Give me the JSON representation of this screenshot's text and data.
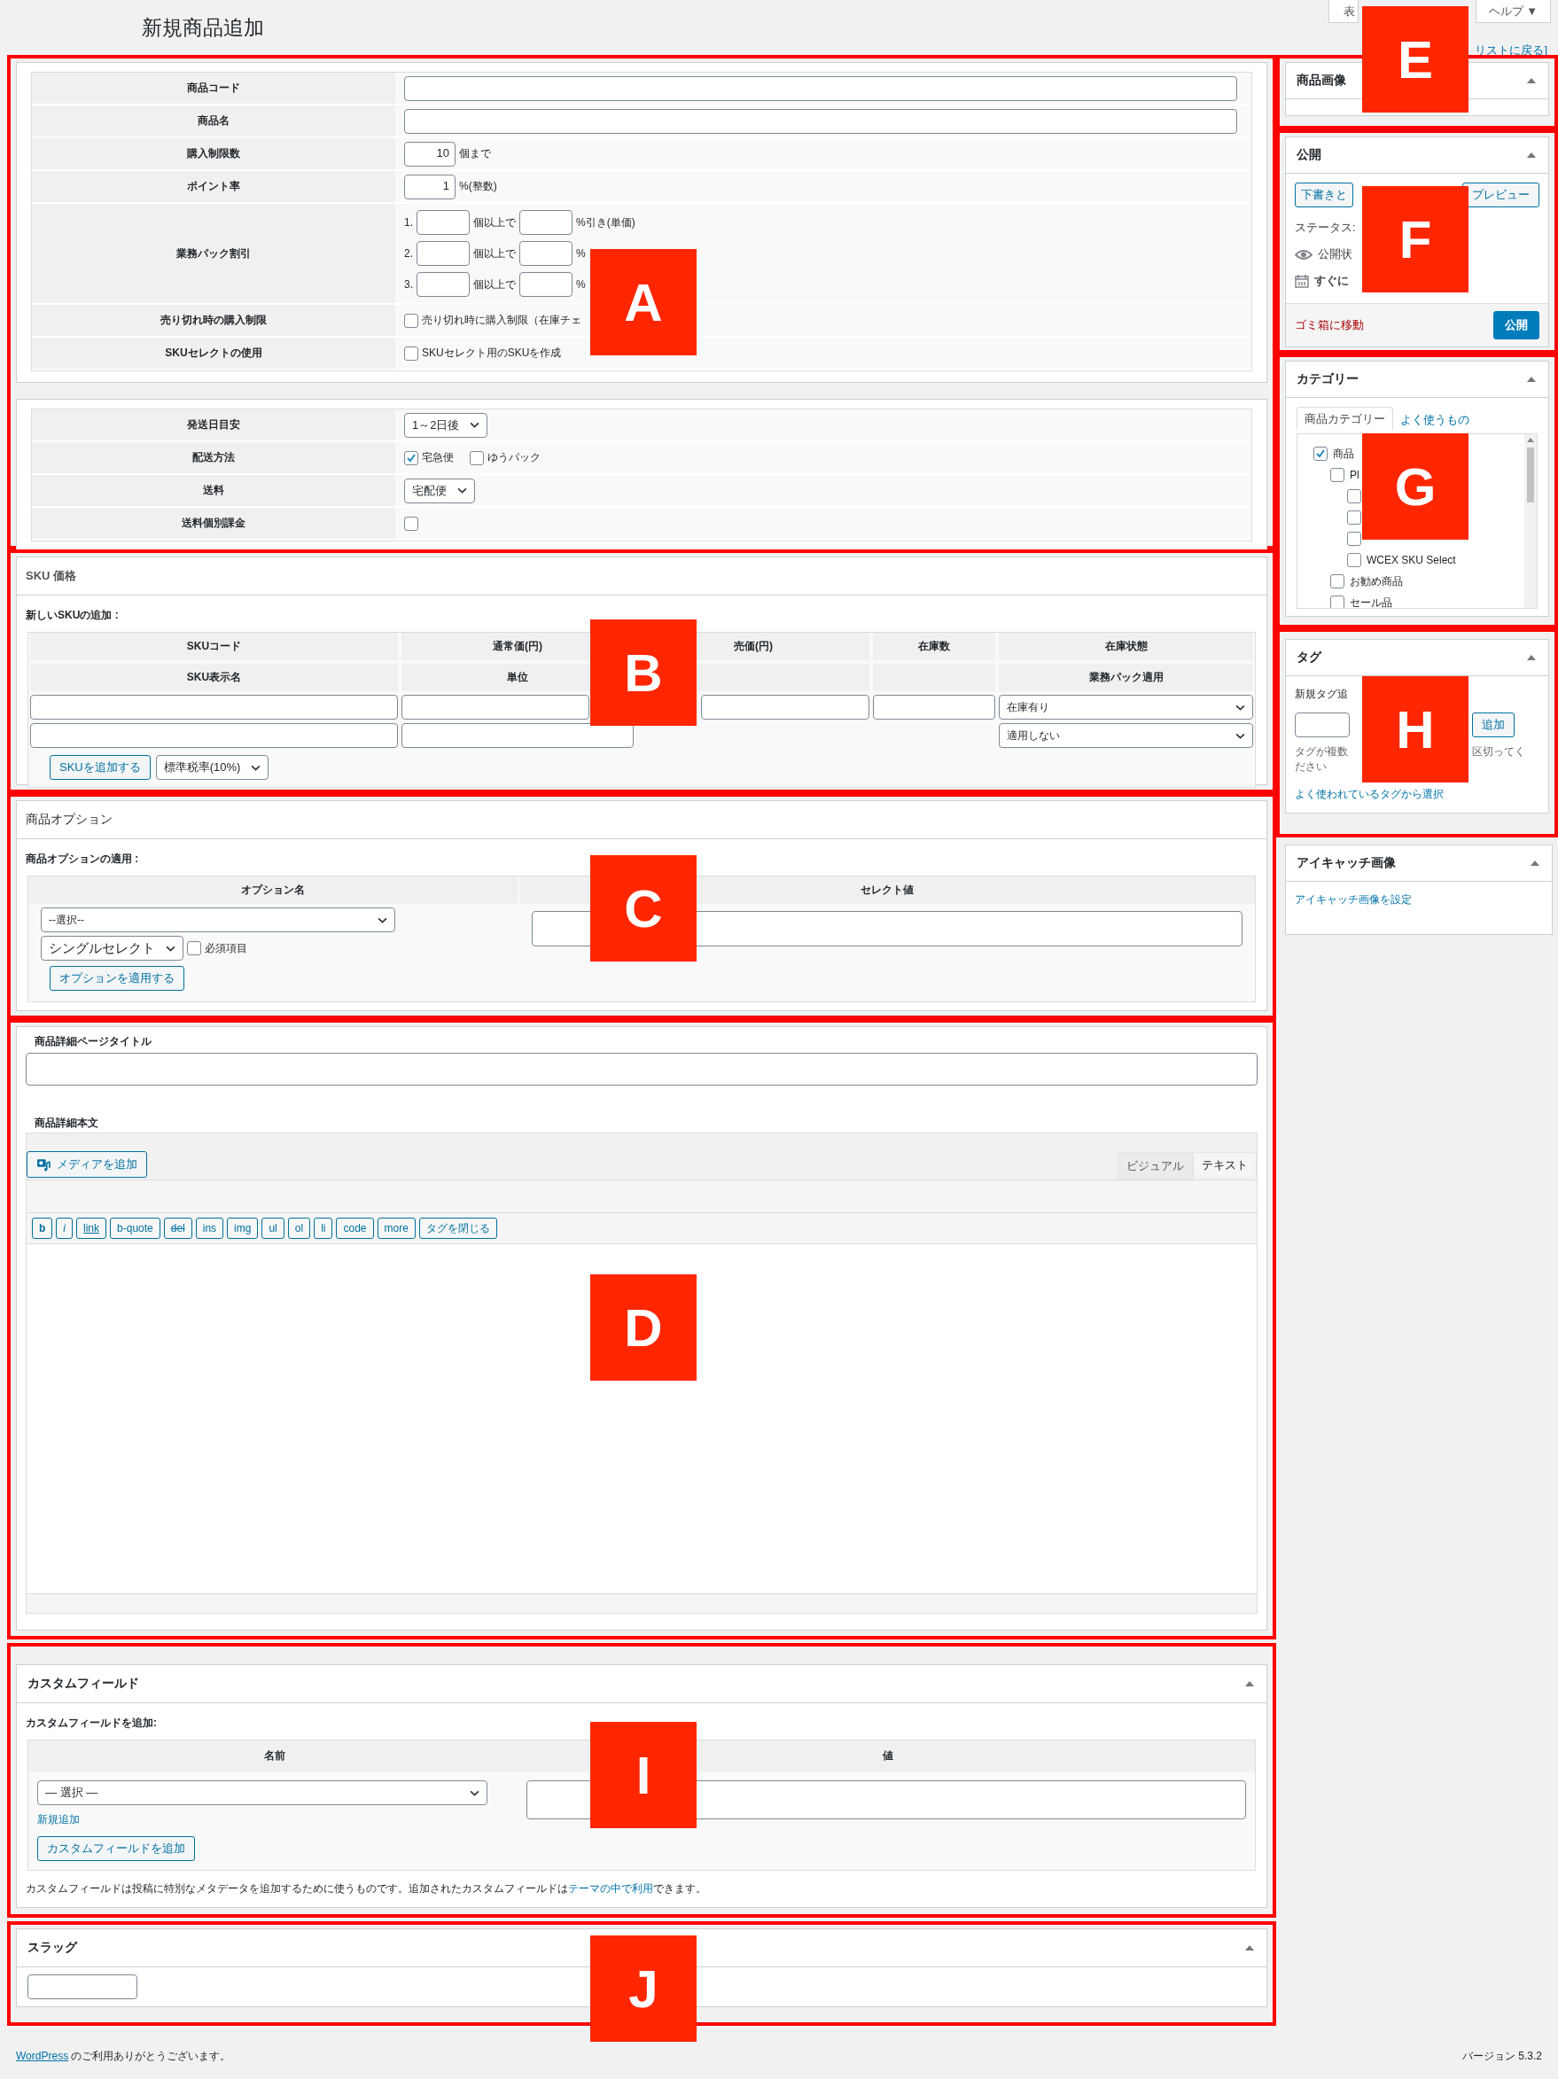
{
  "header": {
    "title": "新規商品追加",
    "screen_options": "表",
    "help": "ヘルプ ▼",
    "back_link": "リストに戻る]"
  },
  "markers": [
    "A",
    "B",
    "C",
    "D",
    "E",
    "F",
    "G",
    "H",
    "I",
    "J"
  ],
  "product": {
    "rows": [
      {
        "kind": "text",
        "label": "商品コード"
      },
      {
        "kind": "text",
        "label": "商品名"
      },
      {
        "kind": "number",
        "label": "購入制限数",
        "value": "10",
        "suffix": "個まで"
      },
      {
        "kind": "number",
        "label": "ポイント率",
        "value": "1",
        "suffix": "%(整数)"
      },
      {
        "kind": "discount",
        "label": "業務パック割引",
        "tiers": [
          {
            "index": "1.",
            "qty_suffix": "個以上で",
            "rate_suffix": "%引き(単価)"
          },
          {
            "index": "2.",
            "qty_suffix": "個以上で",
            "rate_suffix": "%"
          },
          {
            "index": "3.",
            "qty_suffix": "個以上で",
            "rate_suffix": "%"
          }
        ]
      },
      {
        "kind": "checkbox",
        "label": "売り切れ時の購入制限",
        "checked": false,
        "text": "売り切れ時に購入制限（在庫チェ"
      },
      {
        "kind": "checkbox",
        "label": "SKUセレクトの使用",
        "checked": false,
        "text": "SKUセレクト用のSKUを作成"
      }
    ]
  },
  "shipping": {
    "rows": [
      {
        "kind": "select",
        "label": "発送日目安",
        "value": "1～2日後"
      },
      {
        "kind": "checks",
        "label": "配送方法",
        "options": [
          {
            "text": "宅急便",
            "checked": true
          },
          {
            "text": "ゆうパック",
            "checked": false
          }
        ]
      },
      {
        "kind": "select",
        "label": "送料",
        "value": "宅配便"
      },
      {
        "kind": "checkbox",
        "label": "送料個別課金",
        "checked": false
      }
    ]
  },
  "sku": {
    "title": "SKU 価格",
    "subtitle": "新しいSKUの追加 :",
    "header_row_1": [
      "SKUコード",
      "通常価(円)",
      "売価(円)",
      "在庫数",
      "在庫状態"
    ],
    "header_row_2": [
      "SKU表示名",
      "単位",
      "業務パック適用"
    ],
    "stock_select": "在庫有り",
    "pack_select": "適用しない",
    "add_button": "SKUを追加する",
    "tax_select": "標準税率(10%)"
  },
  "options": {
    "title": "商品オプション",
    "subtitle": "商品オプションの適用 :",
    "columns": [
      "オプション名",
      "セレクト値"
    ],
    "name_select": "--選択--",
    "type_select": "シングルセレクト",
    "required": {
      "text": "必須項目",
      "checked": false
    },
    "apply_button": "オプションを適用する"
  },
  "detail": {
    "title_label": "商品詳細ページタイトル",
    "body_label": "商品詳細本文",
    "media_button": "メディアを追加",
    "tabs": [
      {
        "label": "ビジュアル",
        "selected": false
      },
      {
        "label": "テキスト",
        "selected": true
      }
    ],
    "quicktags": [
      {
        "label": "b"
      },
      {
        "label": "i"
      },
      {
        "label": "link"
      },
      {
        "label": "b-quote"
      },
      {
        "label": "del"
      },
      {
        "label": "ins"
      },
      {
        "label": "img"
      },
      {
        "label": "ul"
      },
      {
        "label": "ol"
      },
      {
        "label": "li"
      },
      {
        "label": "code"
      },
      {
        "label": "more"
      },
      {
        "label": "タグを閉じる"
      }
    ]
  },
  "custom_fields": {
    "title": "カスタムフィールド",
    "subtitle": "カスタムフィールドを追加:",
    "columns": [
      "名前",
      "値"
    ],
    "name_select": "— 選択 —",
    "new_link": "新規追加",
    "add_button": "カスタムフィールドを追加",
    "note_before": "カスタムフィールドは投稿に特別なメタデータを追加するために使うものです。追加されたカスタムフィールドは",
    "note_link": "テーマの中で利用",
    "note_after": "できます。"
  },
  "slug": {
    "title": "スラッグ"
  },
  "sidebar": {
    "image": {
      "title": "商品画像"
    },
    "publish": {
      "title": "公開",
      "draft_button": "下書きと",
      "preview_button": "プレビュー",
      "status": "ステータス:",
      "visibility": "公開状",
      "schedule": "すぐに",
      "trash_link": "ゴミ箱に移動",
      "publish_button": "公開"
    },
    "category": {
      "title": "カテゴリー",
      "tabs": [
        {
          "label": "商品カテゴリー",
          "selected": true
        },
        {
          "label": "よく使うもの",
          "selected": false
        }
      ],
      "items": [
        {
          "label": "商品",
          "checked": true,
          "children": [
            {
              "label": "Pl",
              "checked": false,
              "children": [
                {
                  "checked": false
                },
                {
                  "checked": false
                },
                {
                  "checked": false
                },
                {
                  "label": "WCEX SKU Select",
                  "checked": false
                }
              ]
            },
            {
              "label": "お勧め商品",
              "checked": false
            },
            {
              "label": "セール品",
              "checked": false
            }
          ]
        }
      ]
    },
    "tags": {
      "title": "タグ",
      "new_label": "新規タグ追",
      "add_button": "追加",
      "hint_parts": [
        "タグが複数",
        "区切ってく",
        "ださい"
      ],
      "popular_link": "よく使われているタグから選択"
    },
    "featured": {
      "title": "アイキャッチ画像",
      "set_link": "アイキャッチ画像を設定"
    }
  },
  "footer": {
    "link": "WordPress",
    "text": "のご利用ありがとうございます。",
    "version": "バージョン 5.3.2"
  }
}
